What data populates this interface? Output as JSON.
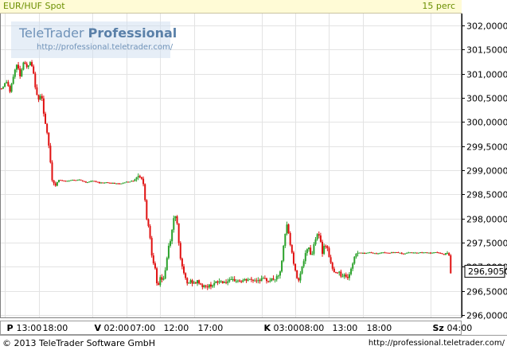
{
  "header": {
    "instrument": "EUR/HUF Spot",
    "interval": "15 perc"
  },
  "watermark": {
    "brand_light": "TeleTrader ",
    "brand_bold": "Professional",
    "url": "http://professional.teletrader.com/"
  },
  "footer": {
    "copyright": "© 2013 TeleTrader Software GmbH",
    "url": "http://professional.teletrader.com/"
  },
  "colors": {
    "up": "#2aa12a",
    "down": "#e01010",
    "grid": "#e3e3e3",
    "header_bg": "#fffbd6"
  },
  "chart_data": {
    "type": "candlestick",
    "ylim": [
      295.95,
      302.25
    ],
    "grid": true,
    "y_ticks": [
      "302,0000",
      "301,5000",
      "301,0000",
      "300,5000",
      "300,0000",
      "299,5000",
      "299,0000",
      "298,5000",
      "298,0000",
      "297,5000",
      "297,0000",
      "296,5000",
      "296,0000"
    ],
    "y_tick_values": [
      302.0,
      301.5,
      301.0,
      300.5,
      300.0,
      299.5,
      299.0,
      298.5,
      298.0,
      297.5,
      297.0,
      296.5,
      296.0
    ],
    "last_price": 296.905,
    "last_price_label": "296,9050",
    "x_ticks": [
      {
        "t": 0.0,
        "day": "P",
        "time": "13:00"
      },
      {
        "t": 5.0,
        "day": "",
        "time": "18:00"
      },
      {
        "t": 13.0,
        "day": "V",
        "time": "02:00"
      },
      {
        "t": 18.0,
        "day": "",
        "time": "07:00"
      },
      {
        "t": 23.0,
        "day": "",
        "time": "12:00"
      },
      {
        "t": 28.0,
        "day": "",
        "time": "17:00"
      },
      {
        "t": 38.0,
        "day": "K",
        "time": "03:00"
      },
      {
        "t": 43.0,
        "day": "",
        "time": "08:00"
      },
      {
        "t": 48.0,
        "day": "",
        "time": "13:00"
      },
      {
        "t": 53.0,
        "day": "",
        "time": "18:00"
      },
      {
        "t": 63.0,
        "day": "Sz",
        "time": "04:00"
      }
    ],
    "x_range": [
      -0.6,
      67.5
    ],
    "close_path": [
      [
        -0.5,
        300.7
      ],
      [
        0.3,
        300.85
      ],
      [
        0.8,
        300.6
      ],
      [
        1.3,
        301.0
      ],
      [
        1.8,
        301.2
      ],
      [
        2.3,
        300.95
      ],
      [
        2.8,
        301.3
      ],
      [
        3.3,
        301.1
      ],
      [
        3.8,
        301.25
      ],
      [
        4.3,
        300.95
      ],
      [
        4.7,
        300.55
      ],
      [
        5.0,
        300.45
      ],
      [
        5.4,
        300.65
      ],
      [
        5.8,
        300.1
      ],
      [
        6.2,
        299.8
      ],
      [
        6.6,
        299.4
      ],
      [
        7.0,
        298.8
      ],
      [
        7.5,
        298.7
      ],
      [
        8.0,
        298.8
      ],
      [
        9.0,
        298.77
      ],
      [
        10.0,
        298.8
      ],
      [
        11.0,
        298.8
      ],
      [
        12.0,
        298.75
      ],
      [
        13.0,
        298.78
      ],
      [
        14.0,
        298.74
      ],
      [
        15.0,
        298.75
      ],
      [
        16.0,
        298.73
      ],
      [
        17.0,
        298.72
      ],
      [
        18.0,
        298.76
      ],
      [
        19.0,
        298.78
      ],
      [
        19.8,
        298.9
      ],
      [
        20.2,
        298.85
      ],
      [
        20.6,
        298.65
      ],
      [
        21.0,
        298.0
      ],
      [
        21.4,
        297.75
      ],
      [
        21.8,
        297.2
      ],
      [
        22.2,
        297.0
      ],
      [
        22.6,
        296.5
      ],
      [
        23.0,
        296.8
      ],
      [
        23.4,
        296.7
      ],
      [
        23.8,
        296.95
      ],
      [
        24.2,
        297.4
      ],
      [
        24.6,
        297.6
      ],
      [
        25.0,
        298.0
      ],
      [
        25.4,
        298.1
      ],
      [
        25.8,
        297.4
      ],
      [
        26.2,
        297.0
      ],
      [
        26.6,
        296.8
      ],
      [
        27.0,
        296.65
      ],
      [
        27.5,
        296.7
      ],
      [
        28.0,
        296.65
      ],
      [
        28.6,
        296.7
      ],
      [
        29.2,
        296.6
      ],
      [
        29.8,
        296.58
      ],
      [
        30.5,
        296.62
      ],
      [
        31.2,
        296.66
      ],
      [
        31.8,
        296.7
      ],
      [
        32.5,
        296.68
      ],
      [
        33.2,
        296.7
      ],
      [
        34.0,
        296.72
      ],
      [
        35.0,
        296.7
      ],
      [
        36.0,
        296.73
      ],
      [
        37.0,
        296.72
      ],
      [
        38.0,
        296.74
      ],
      [
        39.0,
        296.72
      ],
      [
        40.0,
        296.75
      ],
      [
        40.6,
        296.8
      ],
      [
        41.0,
        297.1
      ],
      [
        41.4,
        297.6
      ],
      [
        41.8,
        297.9
      ],
      [
        42.2,
        297.5
      ],
      [
        42.6,
        297.2
      ],
      [
        43.0,
        296.9
      ],
      [
        43.4,
        296.7
      ],
      [
        43.8,
        296.9
      ],
      [
        44.2,
        297.1
      ],
      [
        44.6,
        297.3
      ],
      [
        45.0,
        297.4
      ],
      [
        45.4,
        297.2
      ],
      [
        45.8,
        297.5
      ],
      [
        46.2,
        297.7
      ],
      [
        46.6,
        297.6
      ],
      [
        47.0,
        297.3
      ],
      [
        47.4,
        297.5
      ],
      [
        47.8,
        297.35
      ],
      [
        48.2,
        297.1
      ],
      [
        48.6,
        296.9
      ],
      [
        49.0,
        296.85
      ],
      [
        49.4,
        296.95
      ],
      [
        49.8,
        296.8
      ],
      [
        50.2,
        296.85
      ],
      [
        50.6,
        296.75
      ],
      [
        51.0,
        296.85
      ],
      [
        51.4,
        297.0
      ],
      [
        51.8,
        297.25
      ],
      [
        52.2,
        297.3
      ],
      [
        53.0,
        297.28
      ],
      [
        54.0,
        297.3
      ],
      [
        55.0,
        297.27
      ],
      [
        56.0,
        297.3
      ],
      [
        57.0,
        297.29
      ],
      [
        58.0,
        297.3
      ],
      [
        59.0,
        297.27
      ],
      [
        60.0,
        297.3
      ],
      [
        61.0,
        297.29
      ],
      [
        62.0,
        297.3
      ],
      [
        63.0,
        297.28
      ],
      [
        64.0,
        297.3
      ],
      [
        65.0,
        297.25
      ],
      [
        65.5,
        297.3
      ],
      [
        65.8,
        297.2
      ],
      [
        66.0,
        296.9
      ]
    ]
  }
}
